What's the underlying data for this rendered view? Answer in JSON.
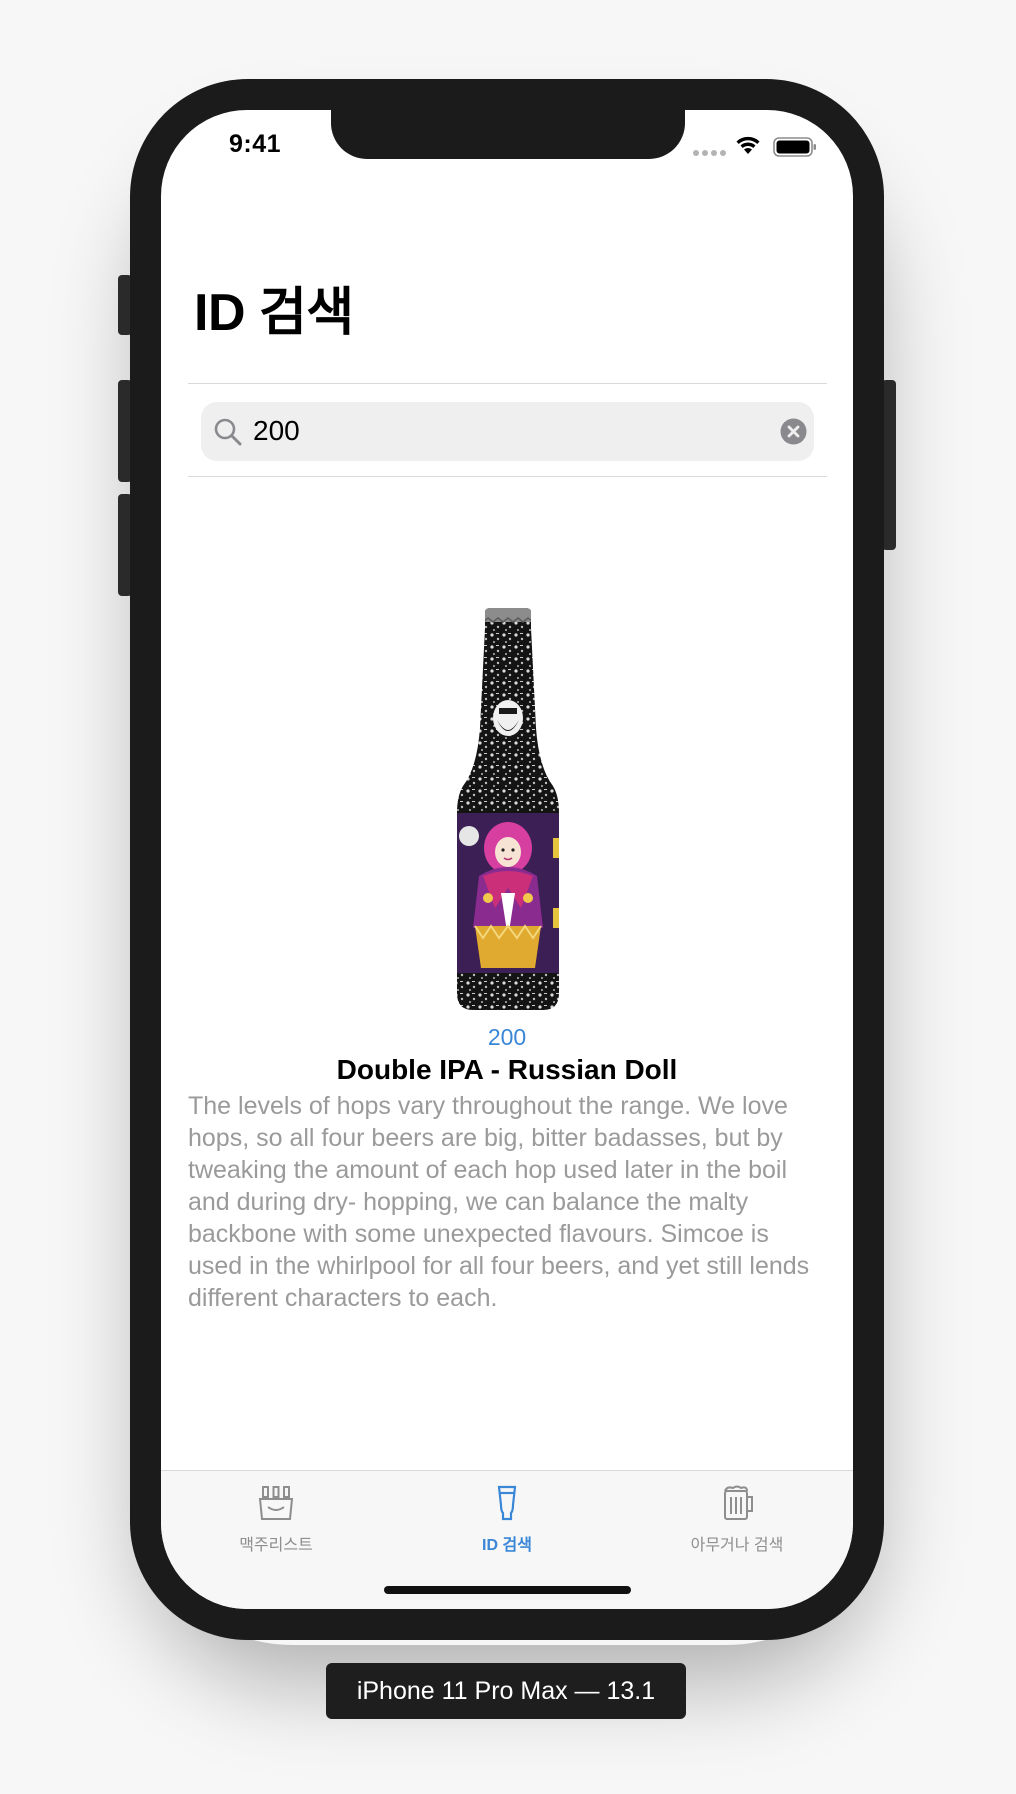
{
  "status_bar": {
    "time": "9:41"
  },
  "navigation": {
    "title": "ID 검색"
  },
  "search": {
    "value": "200",
    "icon": "search-icon",
    "clear_icon": "clear-icon"
  },
  "beer": {
    "id": "200",
    "name": "Double IPA - Russian Doll",
    "description": "The levels of hops vary throughout the range. We love hops, so all four beers are big, bitter badasses, but by tweaking the amount of each hop used later in the boil and during dry- hopping, we can balance the malty backbone with some unexpected flavours. Simcoe is used in the whirlpool for all four beers, and yet still lends different characters to each."
  },
  "tab_bar": {
    "tabs": [
      {
        "label": "맥주리스트",
        "icon": "beer-crate-icon",
        "active": false
      },
      {
        "label": "ID 검색",
        "icon": "beer-glass-icon",
        "active": true
      },
      {
        "label": "아무거나 검색",
        "icon": "beer-mug-icon",
        "active": false
      }
    ]
  },
  "device_caption": "iPhone 11 Pro Max — 13.1",
  "colors": {
    "accent": "#3a87d7",
    "secondary_text": "#9a9a9a",
    "device_frame": "#1b1b1b"
  }
}
